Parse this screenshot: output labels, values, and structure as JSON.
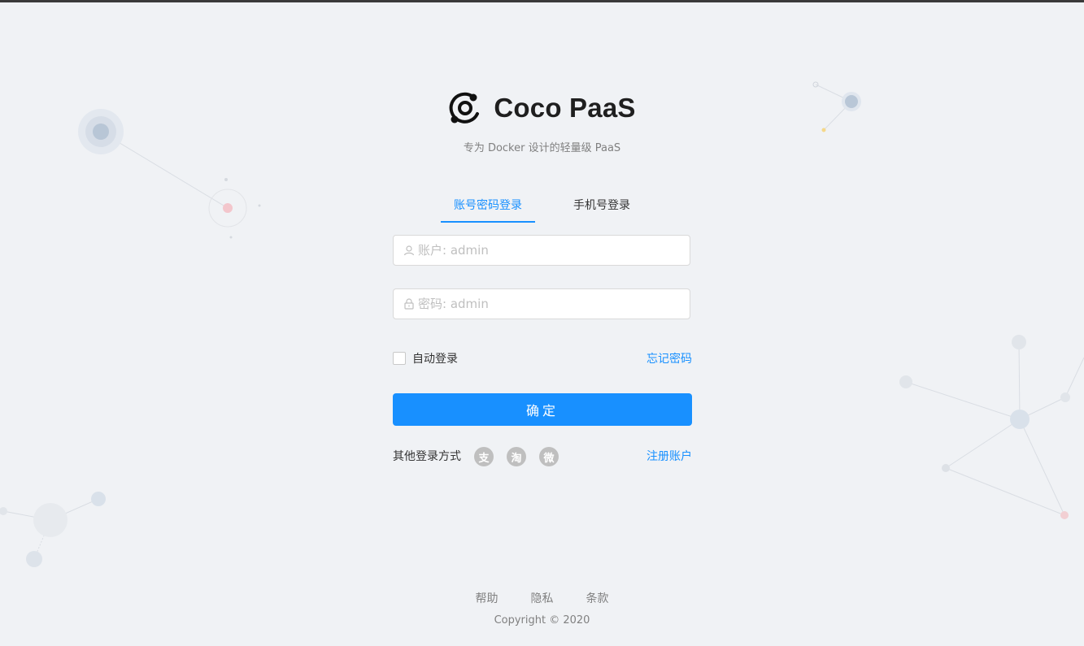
{
  "app": {
    "name": "Coco PaaS",
    "subtitle": "专为 Docker 设计的轻量级 PaaS",
    "logo_icon": "orbit-logo-icon"
  },
  "tabs": [
    {
      "label": "账号密码登录",
      "active": true
    },
    {
      "label": "手机号登录",
      "active": false
    }
  ],
  "form": {
    "username_placeholder": "账户: admin",
    "username_value": "",
    "password_placeholder": "密码: admin",
    "password_value": "",
    "remember_label": "自动登录",
    "remember_checked": false,
    "forgot_label": "忘记密码",
    "submit_label": "确定"
  },
  "social": {
    "label": "其他登录方式",
    "providers": [
      {
        "name": "alipay",
        "icon": "alipay-icon",
        "glyph": "支"
      },
      {
        "name": "taobao",
        "icon": "taobao-icon",
        "glyph": "淘"
      },
      {
        "name": "weibo",
        "icon": "weibo-icon",
        "glyph": "微"
      }
    ],
    "register_label": "注册账户"
  },
  "footer": {
    "links": [
      "帮助",
      "隐私",
      "条款"
    ],
    "copyright": "Copyright © 2020"
  },
  "colors": {
    "primary": "#1890ff",
    "background": "#f0f2f5",
    "muted_text": "#808080"
  }
}
